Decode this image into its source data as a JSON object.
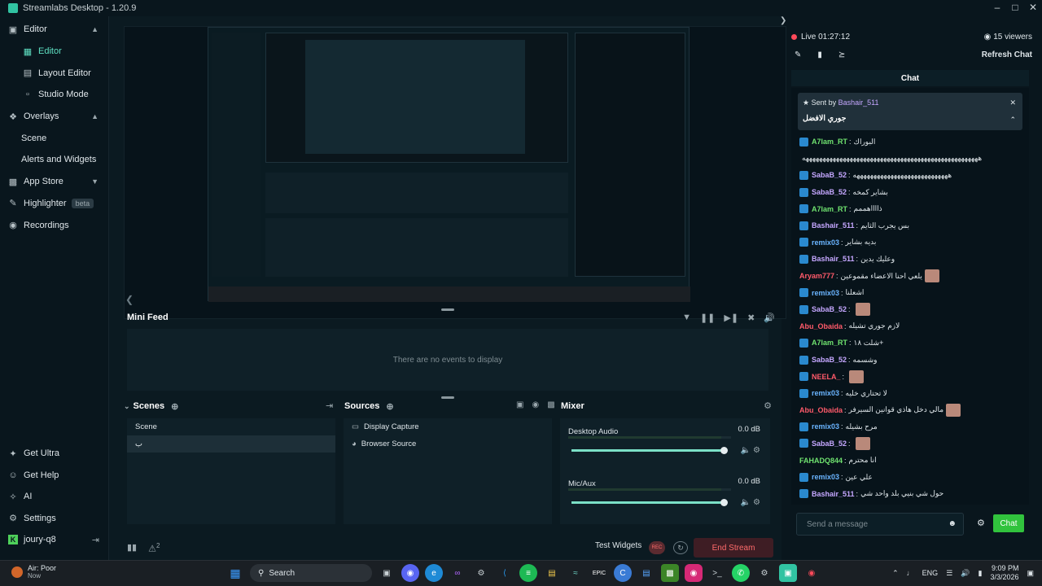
{
  "window": {
    "title": "Streamlabs Desktop - 1.20.9",
    "controls": [
      "minimize-icon",
      "maximize-icon",
      "close-icon"
    ]
  },
  "sidebar": {
    "items": [
      {
        "label": "Editor",
        "icon": "editor-icon",
        "chev": "^"
      },
      {
        "label": "Editor",
        "icon": "grid-icon",
        "active": true
      },
      {
        "label": "Layout Editor",
        "icon": "layout-icon"
      },
      {
        "label": "Studio Mode",
        "icon": "studio-icon"
      },
      {
        "label": "Overlays",
        "icon": "overlays-icon",
        "chev": "^"
      },
      {
        "label": "Scene"
      },
      {
        "label": "Alerts and Widgets"
      },
      {
        "label": "App Store",
        "icon": "app-store-icon",
        "chev": "v"
      },
      {
        "label": "Highlighter",
        "icon": "highlighter-icon",
        "badge": "beta"
      },
      {
        "label": "Recordings",
        "icon": "recordings-icon"
      }
    ],
    "bottom": [
      {
        "label": "Get Ultra",
        "icon": "ultra-icon"
      },
      {
        "label": "Get Help",
        "icon": "help-icon"
      },
      {
        "label": "AI",
        "icon": "ai-icon"
      },
      {
        "label": "Settings",
        "icon": "gear-icon"
      },
      {
        "label": "joury-q8",
        "icon": "kick-icon"
      }
    ]
  },
  "minifeed": {
    "title": "Mini Feed",
    "empty": "There are no events to display"
  },
  "scenes": {
    "title": "Scenes",
    "items": [
      "Scene",
      "ب"
    ]
  },
  "sources": {
    "title": "Sources",
    "items": [
      "Display Capture",
      "Browser Source"
    ]
  },
  "mixer": {
    "title": "Mixer",
    "channels": [
      {
        "name": "Desktop Audio",
        "db": "0.0 dB",
        "volume": 1.0
      },
      {
        "name": "Mic/Aux",
        "db": "0.0 dB",
        "volume": 1.0
      }
    ]
  },
  "footer": {
    "test_widgets": "Test Widgets",
    "rec": "REC",
    "end_stream": "End Stream",
    "alerts_count": "2"
  },
  "chat": {
    "live": "Live 01:27:12",
    "viewers": "15 viewers",
    "refresh": "Refresh Chat",
    "title": "Chat",
    "pinned": {
      "sent_by": "Sent by",
      "user": "Bashair_511",
      "text": "جوري الافضل"
    },
    "messages": [
      {
        "user": "A7lam_RT",
        "color": "#6fe26f",
        "text": "البوراك",
        "mod": true
      },
      {
        "user": "",
        "color": "#dfe6ea",
        "text": "ههههههههههههههههههههههههههههههههههههههههههههههههههههه",
        "mod": false
      },
      {
        "user": "SabaB_52",
        "color": "#c5a7ff",
        "text": "ههههههههههههههههههههههههههههه",
        "mod": true
      },
      {
        "user": "SabaB_52",
        "color": "#c5a7ff",
        "text": "بشاير كمخه",
        "mod": true
      },
      {
        "user": "A7lam_RT",
        "color": "#6fe26f",
        "text": "ذااااهممم",
        "mod": true
      },
      {
        "user": "Bashair_511",
        "color": "#c5a7ff",
        "text": "بس يجرب الثايم",
        "mod": true
      },
      {
        "user": "remix03",
        "color": "#6ab4ff",
        "text": "بديه بشاير",
        "mod": true
      },
      {
        "user": "Bashair_511",
        "color": "#c5a7ff",
        "text": "وعليك يدين",
        "mod": true
      },
      {
        "user": "Aryam777",
        "color": "#ff5a6a",
        "text": "يلعي احنا الاعضاء مقموعين",
        "mod": false,
        "emote": true
      },
      {
        "user": "remix03",
        "color": "#6ab4ff",
        "text": "اشعلنا",
        "mod": true
      },
      {
        "user": "SabaB_52",
        "color": "#c5a7ff",
        "text": "",
        "mod": true,
        "emote": true
      },
      {
        "user": "Abu_Obaida",
        "color": "#ff5a6a",
        "text": "لازم جوري تشيله",
        "mod": false
      },
      {
        "user": "A7lam_RT",
        "color": "#6fe26f",
        "text": "شلت ١٨+",
        "mod": true
      },
      {
        "user": "SabaB_52",
        "color": "#c5a7ff",
        "text": "وشسمه",
        "mod": true
      },
      {
        "user": "NEELA_",
        "color": "#ff5a6a",
        "text": "",
        "mod": true,
        "emote": true
      },
      {
        "user": "remix03",
        "color": "#6ab4ff",
        "text": "لا تحتاري خليه",
        "mod": true
      },
      {
        "user": "Abu_Obaida",
        "color": "#ff5a6a",
        "text": "مالي دخل هاذي قوانين السيرفر",
        "mod": false,
        "emote": true
      },
      {
        "user": "remix03",
        "color": "#6ab4ff",
        "text": "مرح بشيله",
        "mod": true
      },
      {
        "user": "SabaB_52",
        "color": "#c5a7ff",
        "text": "",
        "mod": true,
        "emote": true
      },
      {
        "user": "FAHADQ844",
        "color": "#6fe26f",
        "text": "انا محترم",
        "mod": false
      },
      {
        "user": "remix03",
        "color": "#6ab4ff",
        "text": "علي عين",
        "mod": true
      },
      {
        "user": "Bashair_511",
        "color": "#c5a7ff",
        "text": "حول شي بنيي بلد واحد شي",
        "mod": true
      }
    ],
    "input_placeholder": "Send a message",
    "send": "Chat"
  },
  "taskbar": {
    "weather_title": "Air: Poor",
    "weather_sub": "Now",
    "search": "Search",
    "lang": "ENG",
    "time": "9:09 PM",
    "date": "3/3/2026"
  }
}
